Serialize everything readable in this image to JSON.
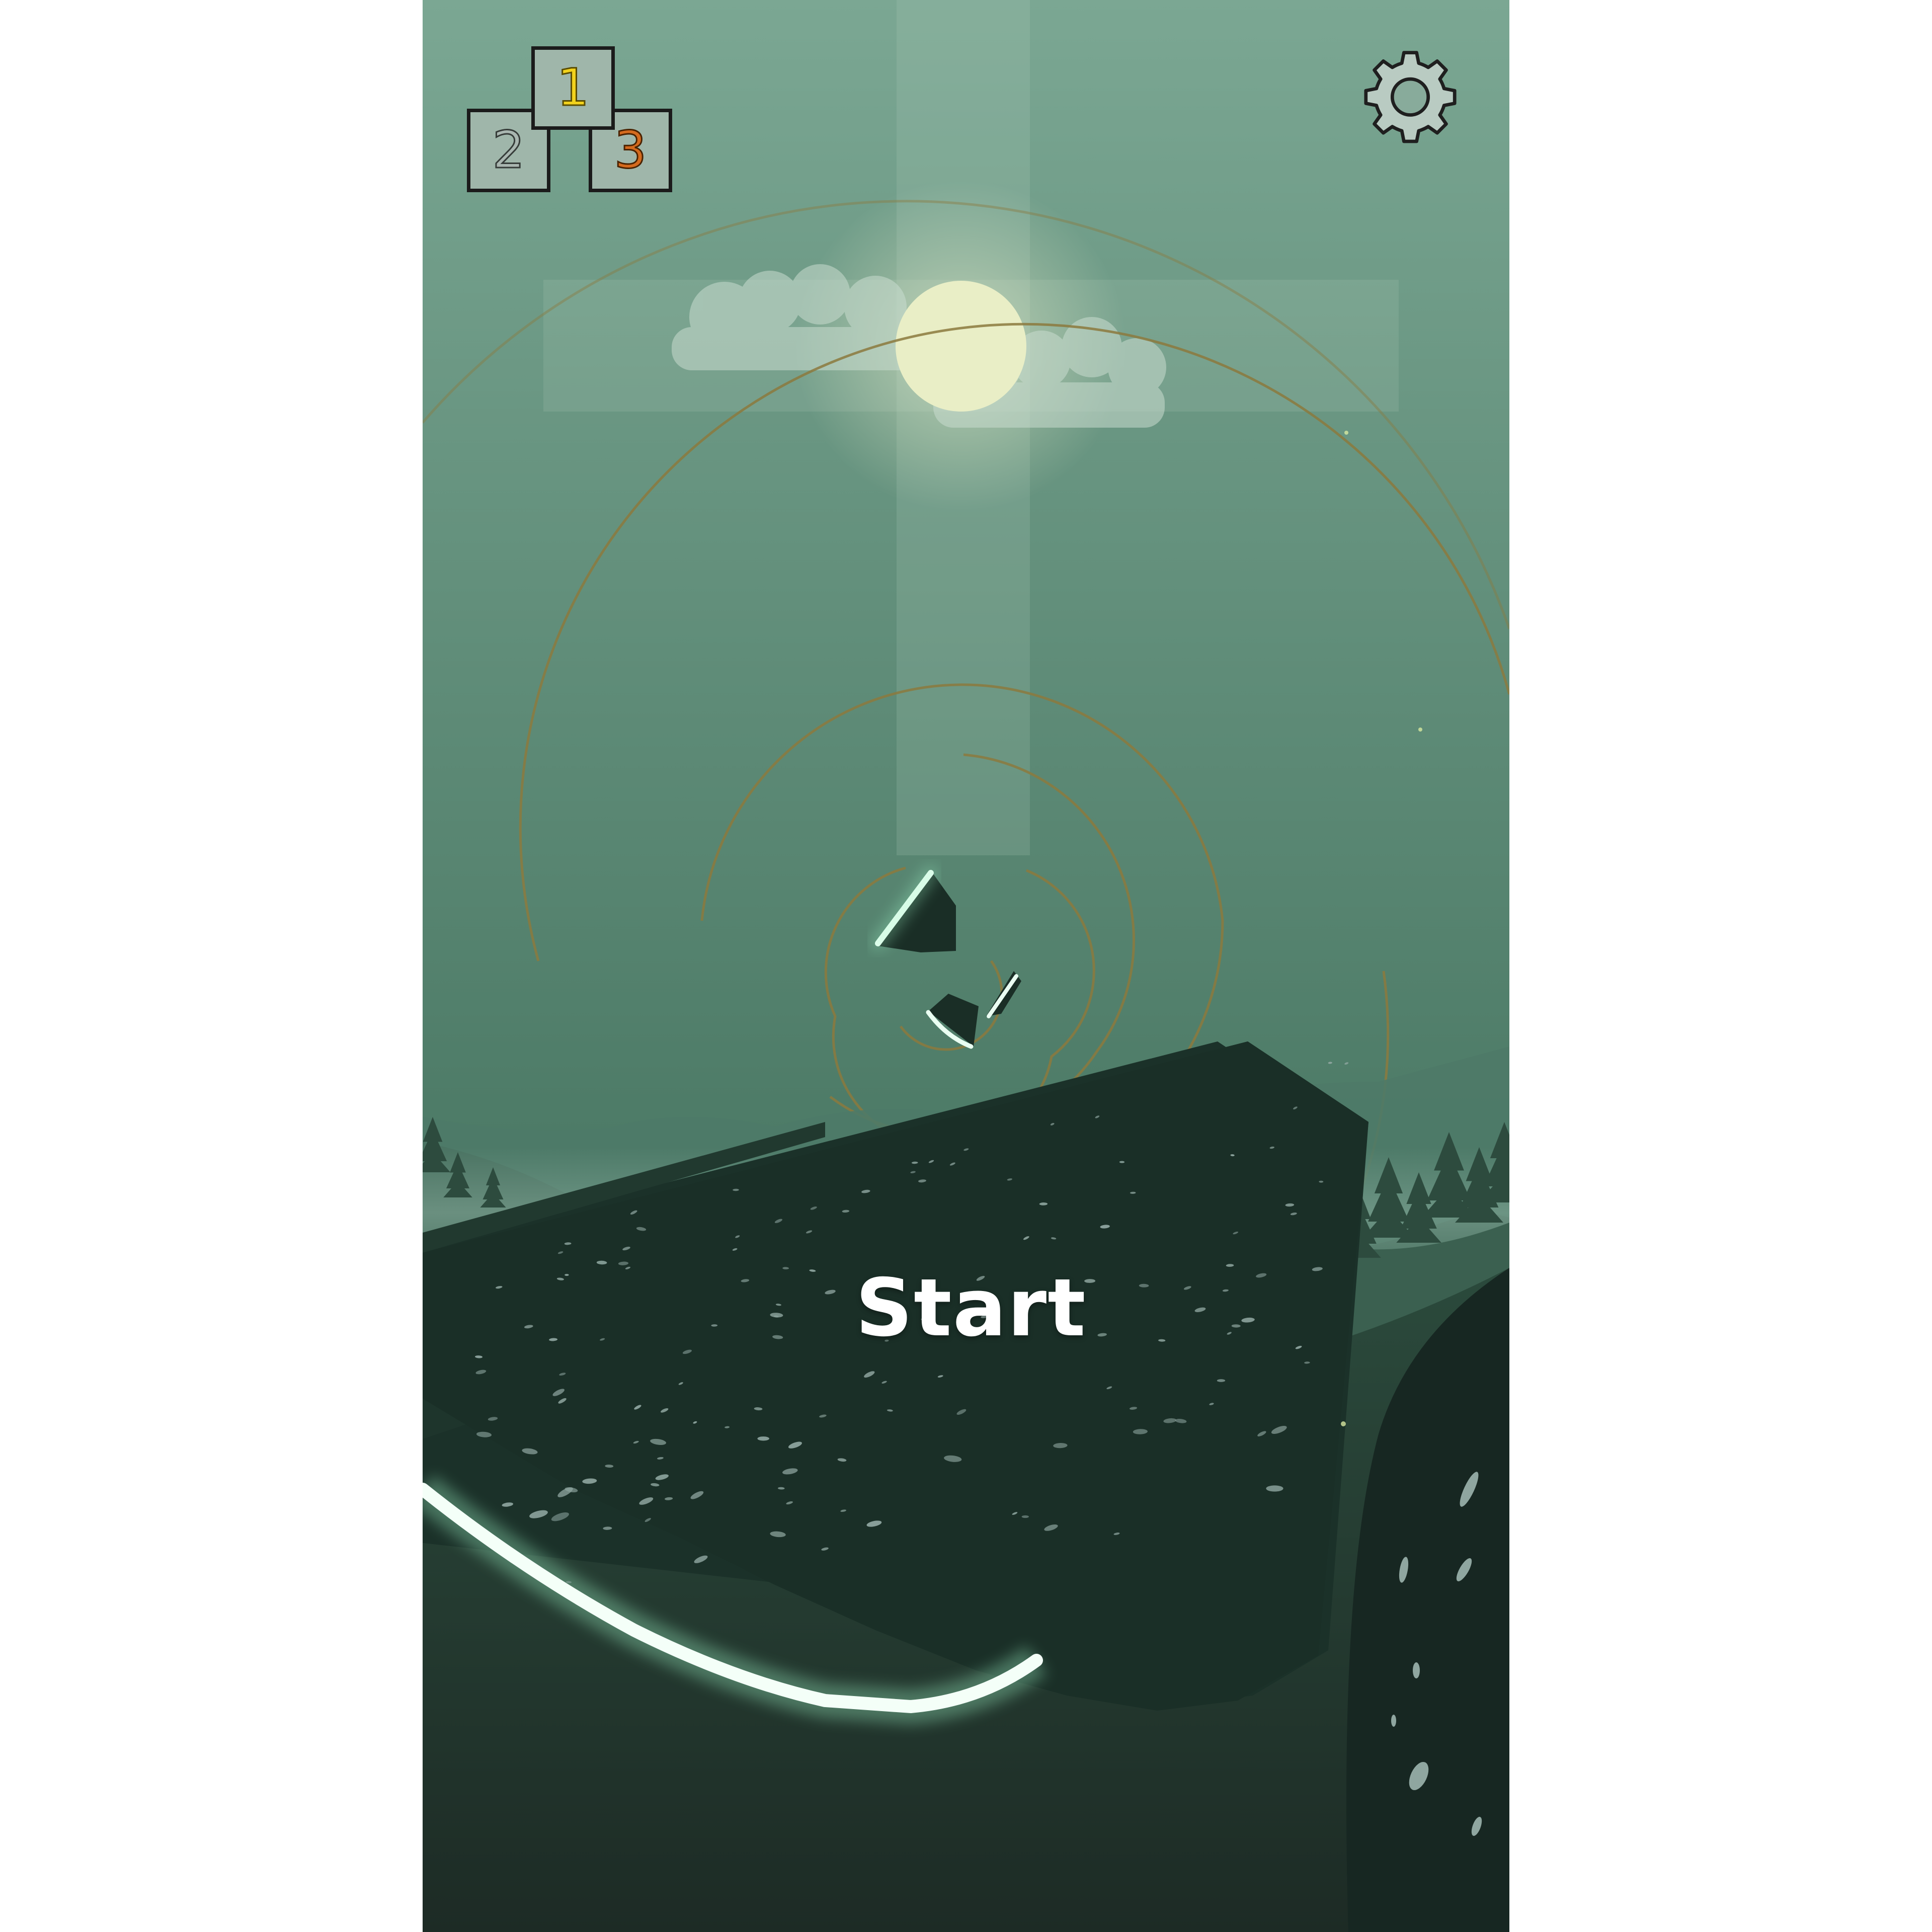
{
  "start_button": {
    "label": "Start"
  },
  "leaderboard": {
    "first_label": "1",
    "second_label": "2",
    "third_label": "3",
    "icon": "podium-icon"
  },
  "settings": {
    "icon": "gear-icon"
  },
  "colors": {
    "sky_top": "#7aa692",
    "sky_bottom": "#3f6a59",
    "moon": "#e8edc8",
    "ring": "#8c7a3e",
    "platform": "#1c3329",
    "glow": "#e9fff3",
    "first_place": "#f2d21c",
    "second_place": "#a9b6b0",
    "third_place": "#d46a1e"
  }
}
